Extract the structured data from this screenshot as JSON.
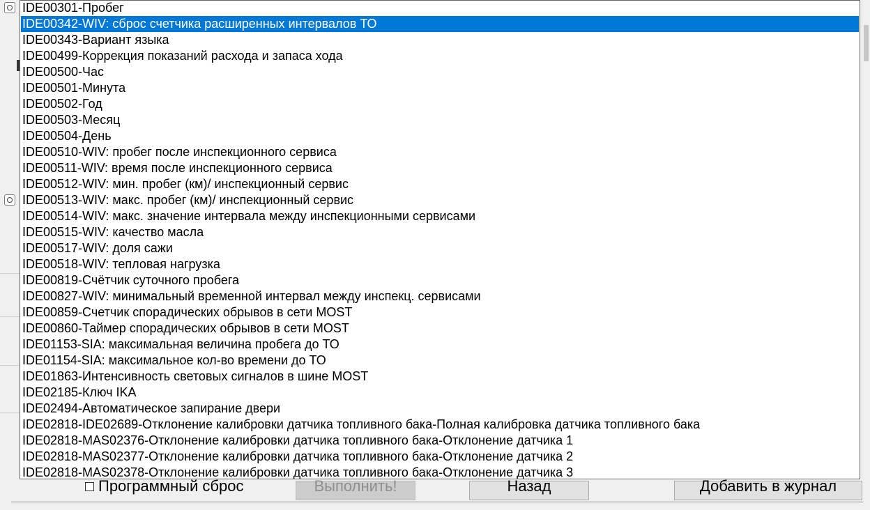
{
  "list": {
    "selected_index": 1,
    "items": [
      "IDE00301-Пробег",
      "IDE00342-WIV: сброс счетчика расширенных интервалов ТО",
      "IDE00343-Вариант языка",
      "IDE00499-Коррекция показаний расхода и запаса хода",
      "IDE00500-Час",
      "IDE00501-Минута",
      "IDE00502-Год",
      "IDE00503-Месяц",
      "IDE00504-День",
      "IDE00510-WIV: пробег после инспекционного сервиса",
      "IDE00511-WIV: время после инспекционного сервиса",
      "IDE00512-WIV: мин. пробег (км)/ инспекционный сервис",
      "IDE00513-WIV: макс. пробег (км)/ инспекционный сервис",
      "IDE00514-WIV: макс. значение интервала между инспекционными сервисами",
      "IDE00515-WIV: качество масла",
      "IDE00517-WIV: доля сажи",
      "IDE00518-WIV: тепловая нагрузка",
      "IDE00819-Счётчик суточного пробега",
      "IDE00827-WIV: минимальный временной интервал между инспекц. сервисами",
      "IDE00859-Счетчик спорадических обрывов в сети MOST",
      "IDE00860-Таймер спорадических обрывов в сети MOST",
      "IDE01153-SIA: максимальная величина пробега до ТО",
      "IDE01154-SIA: максимальное кол-во времени до ТО",
      "IDE01863-Интенсивность световых сигналов в шине MOST",
      "IDE02185-Ключ IKA",
      "IDE02494-Автоматическое запирание двери",
      "IDE02818-IDE02689-Отклонение калибровки датчика топливного бака-Полная калибровка датчика топливного бака",
      "IDE02818-MAS02376-Отклонение калибровки датчика топливного бака-Отклонение датчика 1",
      "IDE02818-MAS02377-Отклонение калибровки датчика топливного бака-Отклонение датчика 2",
      "IDE02818-MAS02378-Отклонение калибровки датчика топливного бака-Отклонение датчика 3"
    ]
  },
  "bottom": {
    "software_reset_label": "Программный сброс",
    "execute_label": "Выполнить!",
    "back_label": "Назад",
    "add_to_log_label": "Добавить в журнал"
  },
  "colors": {
    "selection": "#0078d7",
    "selection_text": "#ffffff",
    "disabled_text": "#8f8f8f"
  }
}
